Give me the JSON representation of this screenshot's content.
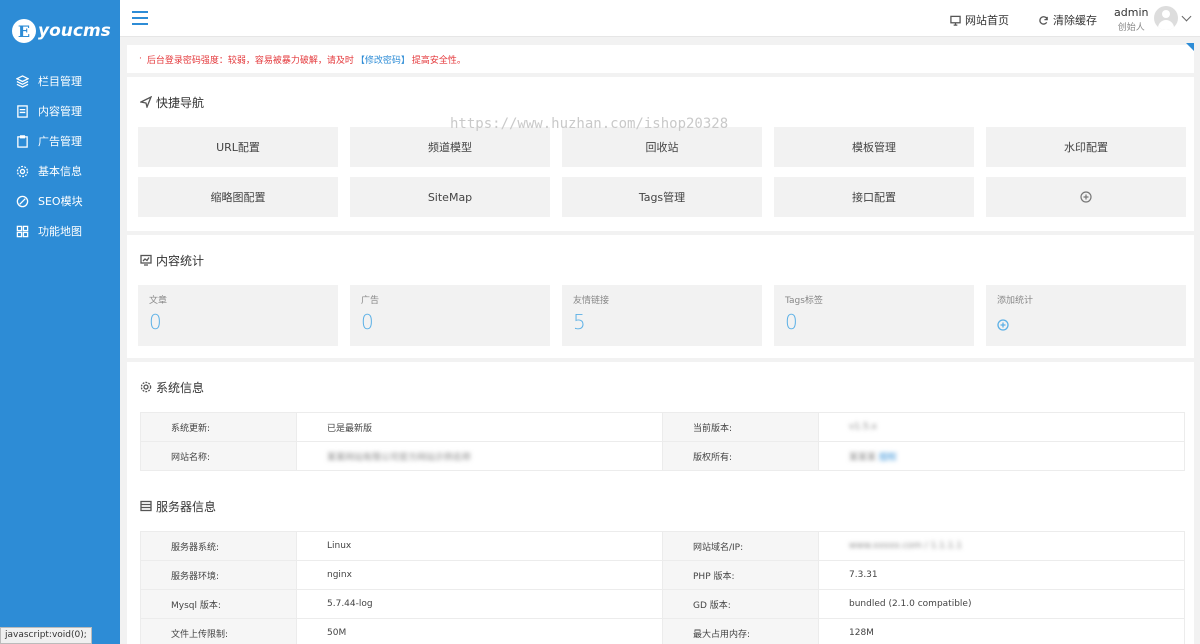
{
  "logo": {
    "badge": "E",
    "text": "youcms"
  },
  "sidebar": {
    "items": [
      {
        "label": "栏目管理",
        "icon": "layers-icon"
      },
      {
        "label": "内容管理",
        "icon": "document-icon"
      },
      {
        "label": "广告管理",
        "icon": "clipboard-icon"
      },
      {
        "label": "基本信息",
        "icon": "gear-icon"
      },
      {
        "label": "SEO模块",
        "icon": "compass-icon"
      },
      {
        "label": "功能地图",
        "icon": "grid-icon"
      }
    ]
  },
  "topbar": {
    "site_home": "网站首页",
    "clear_cache": "清除缓存",
    "user_name": "admin",
    "user_role": "创始人"
  },
  "alert": {
    "prefix": "后台登录密码强度：较弱，容易被暴力破解，请及时",
    "link": "【修改密码】",
    "suffix": "提高安全性。"
  },
  "quick_nav": {
    "title": "快捷导航",
    "items": [
      "URL配置",
      "频道模型",
      "回收站",
      "模板管理",
      "水印配置",
      "缩略图配置",
      "SiteMap",
      "Tags管理",
      "接口配置"
    ]
  },
  "stats": {
    "title": "内容统计",
    "cards": [
      {
        "label": "文章",
        "value": "0"
      },
      {
        "label": "广告",
        "value": "0"
      },
      {
        "label": "友情链接",
        "value": "5"
      },
      {
        "label": "Tags标签",
        "value": "0"
      }
    ],
    "add_label": "添加统计"
  },
  "system_info": {
    "title": "系统信息",
    "rows": [
      {
        "k1": "系统更新:",
        "v1": "已是最新版",
        "k2": "当前版本:",
        "v2": "v1.5.x"
      },
      {
        "k1": "网站名称:",
        "v1": "某某网站有限公司官方网站示例名称",
        "k2": "版权所有:",
        "v2": "某某某",
        "v2_link": "授权"
      }
    ]
  },
  "server_info": {
    "title": "服务器信息",
    "rows": [
      {
        "k1": "服务器系统:",
        "v1": "Linux",
        "k2": "网站域名/IP:",
        "v2": "www.xxxxx.com / 1.1.1.1"
      },
      {
        "k1": "服务器环境:",
        "v1": "nginx",
        "k2": "PHP 版本:",
        "v2": "7.3.31"
      },
      {
        "k1": "Mysql 版本:",
        "v1": "5.7.44-log",
        "k2": "GD 版本:",
        "v2": "bundled (2.1.0 compatible)"
      },
      {
        "k1": "文件上传限制:",
        "v1": "50M",
        "k2": "最大占用内存:",
        "v2": "128M"
      }
    ]
  },
  "watermark": "https://www.huzhan.com/ishop20328",
  "status_tip": "javascript:void(0);",
  "colors": {
    "accent": "#2d8cd6",
    "alert": "#e4393c",
    "stat_value": "#5bb0e6"
  }
}
